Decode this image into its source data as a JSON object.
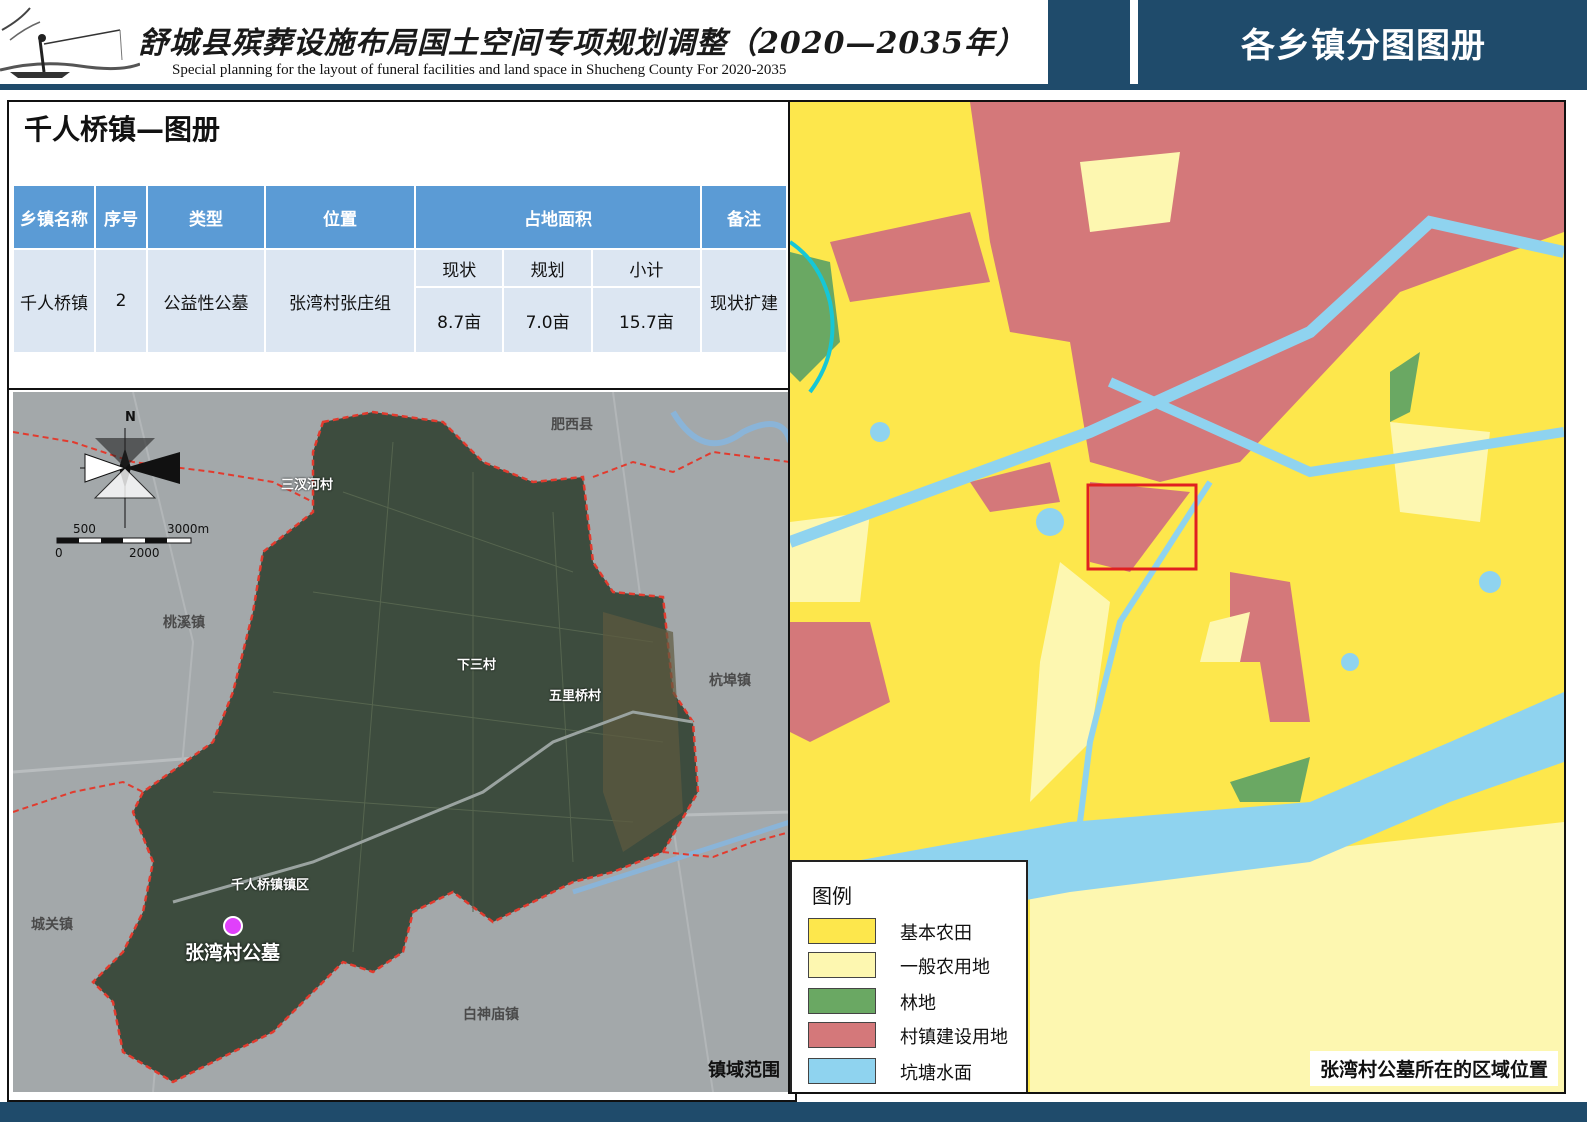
{
  "header": {
    "title_cn": "舒城县殡葬设施布局国土空间专项规划调整（2020—2035年）",
    "title_en": "Special planning for the layout of funeral facilities and land space in Shucheng County For 2020-2035",
    "right_title": "各乡镇分图图册"
  },
  "left": {
    "town_title": "千人桥镇—图册",
    "table": {
      "headers": [
        "乡镇名称",
        "序号",
        "类型",
        "位置",
        "占地面积",
        "备注"
      ],
      "area_subheaders": [
        "现状",
        "规划",
        "小计"
      ],
      "row": {
        "town": "千人桥镇",
        "index": "2",
        "type": "公益性公墓",
        "location": "张湾村张庄组",
        "current": "8.7亩",
        "planned": "7.0亩",
        "subtotal": "15.7亩",
        "note": "现状扩建"
      }
    },
    "map": {
      "north": "N",
      "scale_top_left": "500",
      "scale_top_right": "3000m",
      "scale_bottom_left": "0",
      "scale_bottom_mid": "2000",
      "neighbors": [
        "肥西县",
        "桃溪镇",
        "杭埠镇",
        "城关镇",
        "白神庙镇"
      ],
      "villages": [
        "三汊河村",
        "下三村",
        "五里桥村",
        "千人桥镇镇区"
      ],
      "site_label": "张湾村公墓",
      "extent_label": "镇域范围"
    }
  },
  "right": {
    "legend": {
      "title": "图例",
      "items": [
        {
          "label": "基本农田",
          "color": "#fde74c"
        },
        {
          "label": "一般农用地",
          "color": "#fdf7b0"
        },
        {
          "label": "林地",
          "color": "#6aa863"
        },
        {
          "label": "村镇建设用地",
          "color": "#d4787a"
        },
        {
          "label": "坑塘水面",
          "color": "#8fd3ef"
        }
      ]
    },
    "caption": "张湾村公墓所在的区域位置",
    "colors": {
      "basic_farmland": "#fde74c",
      "general_farmland": "#fdf7b0",
      "forest": "#6aa863",
      "construction": "#d4787a",
      "water": "#8fd3ef",
      "highlight": "#e02020"
    }
  }
}
